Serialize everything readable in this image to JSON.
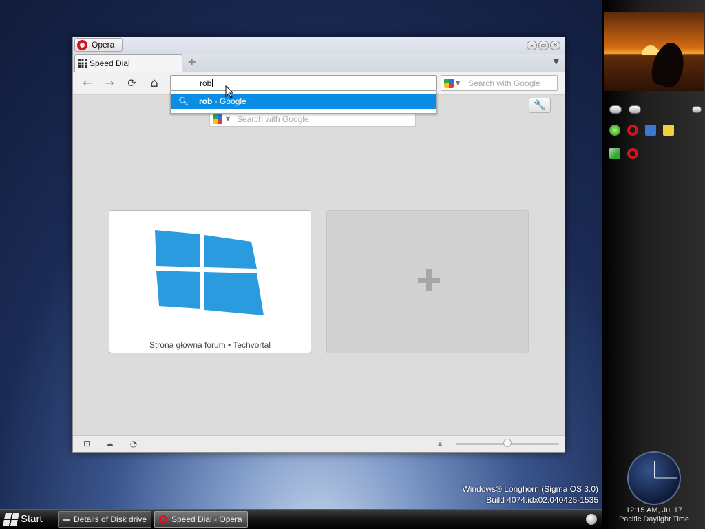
{
  "desktop": {
    "watermark_line1": "Windows® Longhorn (Sigma OS 3.0)",
    "watermark_line2": "Build 4074.idx02.040425-1535"
  },
  "browser": {
    "menu_label": "Opera",
    "window_controls": [
      "⌄",
      "▭",
      "✕"
    ],
    "tab": {
      "label": "Speed Dial"
    },
    "new_tab_icon": "+",
    "toolbar": {
      "back_icon": "←",
      "forward_icon": "→",
      "reload_icon": "⟳",
      "home_icon": "⌂",
      "address_value": "rob",
      "search_placeholder": "Search with Google"
    },
    "suggestion": {
      "query": "rob",
      "suffix": " - Google"
    },
    "speed_dial": {
      "search_placeholder": "Search with Google",
      "dial_1_title": "Strona główna forum • Techvortal",
      "add_symbol": "+"
    },
    "colors": {
      "accent": "#0b8de6",
      "windows_logo": "#2b9be0",
      "opera_red": "#d9111c"
    }
  },
  "taskbar": {
    "start_label": "Start",
    "items": [
      {
        "label": "Details of Disk drive"
      },
      {
        "label": "Speed Dial - Opera"
      }
    ]
  },
  "sidebar": {
    "clock_time": "12:15 AM, Jul 17",
    "clock_zone": "Pacific Daylight Time"
  }
}
